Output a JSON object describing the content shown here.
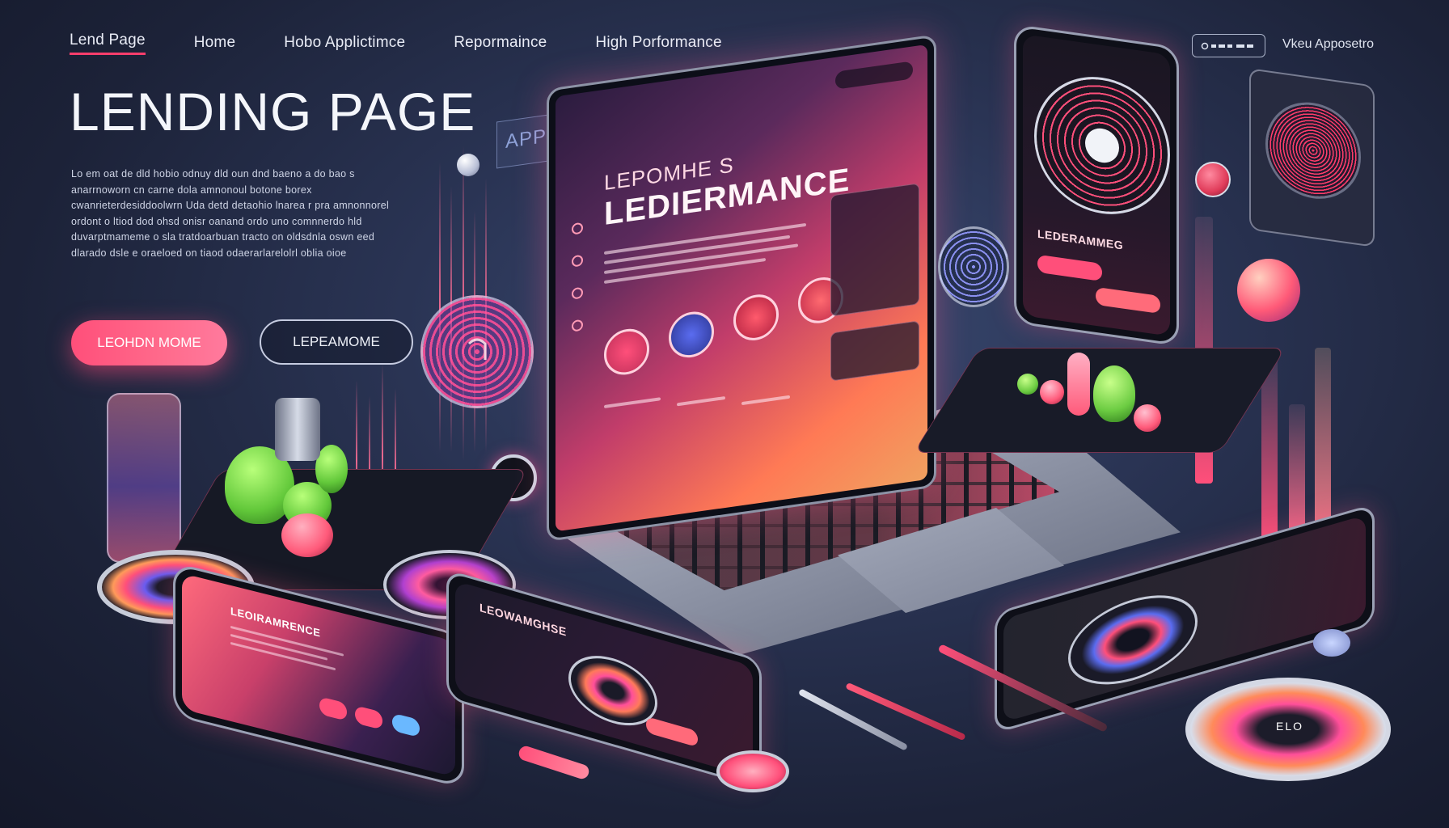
{
  "nav": {
    "links": [
      "Lend Page",
      "Home",
      "Hobo Applictimce",
      "Repormaince",
      "High Porformance"
    ],
    "button_label": "",
    "right_label": "Vkeu Apposetro"
  },
  "hero": {
    "title": "LENDING PAGE",
    "body": "Lo em oat de dld hobio odnuy dld oun dnd baeno a do bao s anarrnoworn cn carne dola amnonoul botone borex cwanrieterdesiddoolwrn Uda detd detaohio lnarea r pra amnonnorel ordont o ltiod dod ohsd onisr oanand ordo uno comnnerdo hld duvarptmameme o sla tratdoarbuan tracto on oldsdnla oswn eed dlarado dsle e oraeloed on tiaod odaerarlarelolrl oblia oioe",
    "primary_button": "LEOHDN MOME",
    "secondary_button": "LEPEAMOME"
  },
  "floating_labels": {
    "application": "APPLICATOR"
  },
  "laptop": {
    "kicker": "LEPOMHE S",
    "title": "LEDIERMANCE"
  },
  "right_card": {
    "title": "LEDERAMMEG"
  },
  "tablet": {
    "title": "LEOWAMGHSE"
  },
  "phone": {
    "title": "LEOIRAMRENCE"
  },
  "disc_label": "ELO",
  "colors": {
    "accent": "#ff4f7a",
    "background": "#1c2238"
  }
}
